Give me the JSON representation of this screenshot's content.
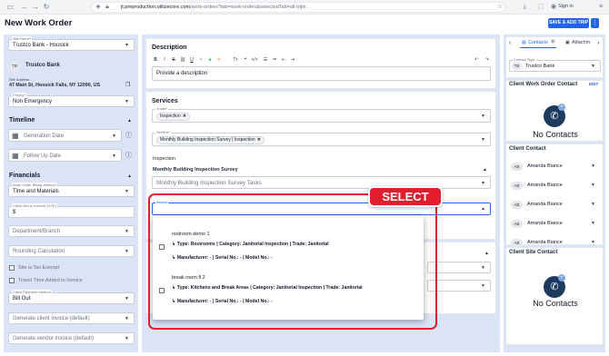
{
  "browser": {
    "url_host": "jt.preproduction.utilizecore.com",
    "url_path": "/work-orders?tab=work-orders&selectedTab=all-trips",
    "sign_in": "Sign in"
  },
  "header": {
    "title": "New Work Order",
    "save_button": "SAVE & ADD TRIP",
    "more_button": "⋮"
  },
  "left": {
    "site_name": {
      "label": "Site Name*",
      "value": "Trustco Bank - Hoosick"
    },
    "company": {
      "initials": "TB",
      "name": "Trustco Bank"
    },
    "site_address": {
      "label": "Site Address",
      "value": "47 Main St, Hoosick Falls, NY 12090, US"
    },
    "priority": {
      "label": "Priority*",
      "value": "Non Emergency"
    },
    "timeline": {
      "title": "Timeline",
      "generation_date": "Generation Date",
      "follow_up_date": "Follow Up Date"
    },
    "financials": {
      "title": "Financials",
      "billing_method": {
        "label": "Work Order Billing Method",
        "value": "Time and Materials"
      },
      "nte": {
        "label": "Client Not to exceed (NTE)",
        "value": "$"
      },
      "department": "Department/Branch",
      "rounding": "Rounding Calculation",
      "tax_exempt": "Site is Tax Exempt",
      "travel_time": "Travel Time Added to Invoice",
      "payment_method": {
        "label": "Client Payment Method",
        "value": "Bill Out"
      },
      "client_invoice": "Generate client invoice (default)",
      "vendor_invoice": "Generate vendor invoice (default)"
    }
  },
  "center": {
    "description": {
      "title": "Description",
      "placeholder": "Provide a description"
    },
    "services": {
      "title": "Services",
      "trade": {
        "label": "Trade*",
        "chip": "Inspection"
      },
      "service": {
        "label": "Service*",
        "chip": "Monthly Building Inspection Survey | Inspection"
      },
      "inspection_label": "Inspection",
      "survey_title": "Monthly Building Inspection Survey",
      "survey_tasks": "Monthly Building Inspection Survey Tasks",
      "assets_label": "Assets"
    },
    "annotation": "SELECT",
    "assets_popup": [
      {
        "name": "restroom demo 1",
        "line1": "↳ Type: Restrooms | Category: Janitorial Inspection | Trade: Janitorial",
        "line2": "↳ Manufacturer: - | Serial No.: - | Model No.: -"
      },
      {
        "name": "break room fl 2",
        "line1": "↳ Type: Kitchens and Break Areas | Category: Janitorial Inspection | Trade: Janitorial",
        "line2": "↳ Manufacturer: - | Serial No.: - | Model No.: -"
      }
    ]
  },
  "right": {
    "tabs": {
      "contacts": "Contacts",
      "contacts_count": "0",
      "attachments": "Attachm"
    },
    "contact_type": {
      "label": "Contact Type",
      "initials": "TB",
      "value": "Trustco Bank"
    },
    "client_wo_contact": {
      "title": "Client Work Order Contact",
      "edit": "EDIT",
      "empty": "No Contacts"
    },
    "client_contact": {
      "title": "Client Contact",
      "items": [
        {
          "initials": "AB",
          "name": "Amanda Biance"
        },
        {
          "initials": "AB",
          "name": "Amanda Biance"
        },
        {
          "initials": "AB",
          "name": "Amanda Biance"
        },
        {
          "initials": "AB",
          "name": "Amanda Biance"
        },
        {
          "initials": "AB",
          "name": "Amanda Biance"
        }
      ]
    },
    "client_site_contact": {
      "title": "Client Site Contact",
      "empty": "No Contacts"
    }
  }
}
